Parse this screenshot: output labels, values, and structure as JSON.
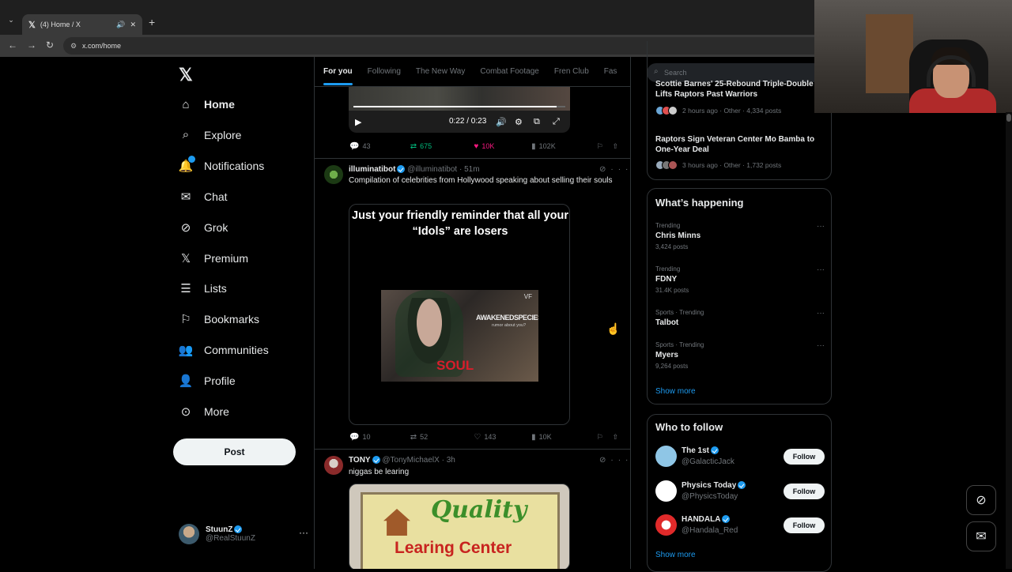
{
  "browser": {
    "tab_title": "(4) Home / X",
    "url": "x.com/home"
  },
  "sidebar": {
    "logo": "X",
    "items": [
      {
        "label": "Home",
        "icon": "home-icon"
      },
      {
        "label": "Explore",
        "icon": "search-icon"
      },
      {
        "label": "Notifications",
        "icon": "bell-icon"
      },
      {
        "label": "Chat",
        "icon": "mail-icon"
      },
      {
        "label": "Grok",
        "icon": "grok-icon"
      },
      {
        "label": "Premium",
        "icon": "x-icon"
      },
      {
        "label": "Lists",
        "icon": "list-icon"
      },
      {
        "label": "Bookmarks",
        "icon": "bookmark-icon"
      },
      {
        "label": "Communities",
        "icon": "people-icon"
      },
      {
        "label": "Profile",
        "icon": "person-icon"
      },
      {
        "label": "More",
        "icon": "more-circle-icon"
      }
    ],
    "post_label": "Post",
    "account": {
      "name": "StuunZ",
      "handle": "@RealStuunZ"
    }
  },
  "feed": {
    "tabs": [
      "For you",
      "Following",
      "The New Way",
      "Combat Footage",
      "Fren Club",
      "Fas"
    ],
    "video_tweet": {
      "time": "0:22 / 0:23",
      "progress": 0.96,
      "replies": "43",
      "reposts": "675",
      "likes": "10K",
      "views": "102K"
    },
    "tweets": [
      {
        "name": "illuminatibot",
        "handle": "@illuminatibot",
        "time": "51m",
        "text": "Compilation of celebrities from Hollywood speaking about selling their souls",
        "media_caption": "Just your friendly reminder that all your “Idols” are losers",
        "media_brand": "AWAKENEDSPECIES",
        "media_sub": "rumor about you?",
        "media_word": "SOUL",
        "media_corner": "VF",
        "replies": "10",
        "reposts": "52",
        "likes": "143",
        "views": "10K"
      },
      {
        "name": "TONY",
        "handle": "@TonyMichaelX",
        "time": "3h",
        "text": "niggas be learing",
        "media_line1": "Quality",
        "media_line2": "Learing Center"
      }
    ]
  },
  "right": {
    "search_placeholder": "Search",
    "news": [
      {
        "title": "Scottie Barnes' 25-Rebound Triple-Double Lifts Raptors Past Warriors",
        "meta": "2 hours ago · Other · 4,334 posts"
      },
      {
        "title": "Raptors Sign Veteran Center Mo Bamba to One-Year Deal",
        "meta": "3 hours ago · Other · 1,732 posts"
      }
    ],
    "whats_happening": "What’s happening",
    "trends": [
      {
        "context": "Trending",
        "name": "Chris Minns",
        "count": "3,424 posts"
      },
      {
        "context": "Trending",
        "name": "FDNY",
        "count": "31.4K posts"
      },
      {
        "context": "Sports · Trending",
        "name": "Talbot",
        "count": ""
      },
      {
        "context": "Sports · Trending",
        "name": "Myers",
        "count": "9,264 posts"
      }
    ],
    "show_more": "Show more",
    "who_to_follow": "Who to follow",
    "follow_suggestions": [
      {
        "name": "The 1st",
        "handle": "@GalacticJack",
        "color": "#8fc6e6"
      },
      {
        "name": "Physics Today",
        "handle": "@PhysicsToday",
        "color": "#ffffff"
      },
      {
        "name": "HANDALA",
        "handle": "@Handala_Red",
        "color": "#e02a2a"
      }
    ],
    "follow_label": "Follow",
    "show_more_2": "Show more"
  },
  "colors": {
    "accent": "#1d9bf0",
    "background": "#000000",
    "like": "#f91880",
    "repost": "#00ba7c"
  }
}
